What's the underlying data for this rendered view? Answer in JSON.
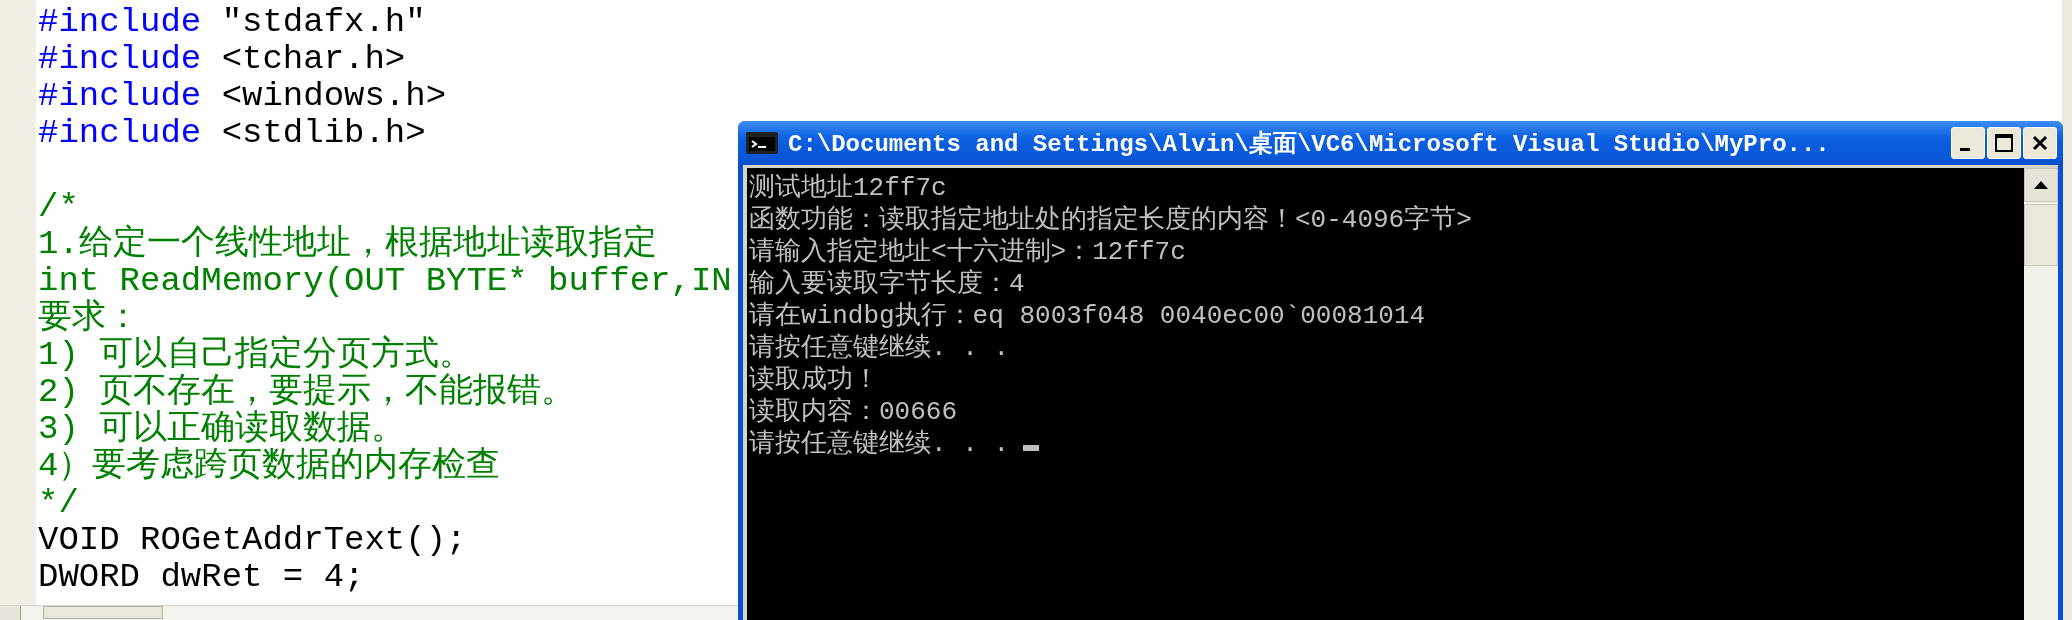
{
  "editor": {
    "lines": [
      {
        "kind": "include",
        "keyword": "#include",
        "text": " \"stdafx.h\""
      },
      {
        "kind": "include",
        "keyword": "#include",
        "text": " <tchar.h>"
      },
      {
        "kind": "include",
        "keyword": "#include",
        "text": " <windows.h>"
      },
      {
        "kind": "include",
        "keyword": "#include",
        "text": " <stdlib.h>"
      },
      {
        "kind": "blank"
      },
      {
        "kind": "comment",
        "text": "/*"
      },
      {
        "kind": "comment",
        "text": "1.给定一个线性地址，根据地址读取指定"
      },
      {
        "kind": "comment",
        "text": "int ReadMemory(OUT BYTE* buffer,IN"
      },
      {
        "kind": "comment",
        "text": "要求："
      },
      {
        "kind": "comment",
        "text": "1) 可以自己指定分页方式。"
      },
      {
        "kind": "comment",
        "text": "2) 页不存在，要提示，不能报错。"
      },
      {
        "kind": "comment",
        "text": "3) 可以正确读取数据。"
      },
      {
        "kind": "comment",
        "text": "4）要考虑跨页数据的内存检查"
      },
      {
        "kind": "comment",
        "text": "*/"
      },
      {
        "kind": "code",
        "text": "VOID ROGetAddrText();"
      },
      {
        "kind": "code",
        "text": "DWORD dwRet = 4;"
      }
    ]
  },
  "console": {
    "title": "C:\\Documents and Settings\\Alvin\\桌面\\VC6\\Microsoft Visual Studio\\MyPro...",
    "cursor": true,
    "lines": [
      "测试地址12ff7c",
      "函数功能：读取指定地址处的指定长度的内容！<0-4096字节>",
      "请输入指定地址<十六进制>：12ff7c",
      "输入要读取字节长度：4",
      "请在windbg执行：eq 8003f048 0040ec00`00081014",
      "请按任意键继续. . .",
      "读取成功！",
      "读取内容：00666",
      "请按任意键继续. . ."
    ]
  }
}
